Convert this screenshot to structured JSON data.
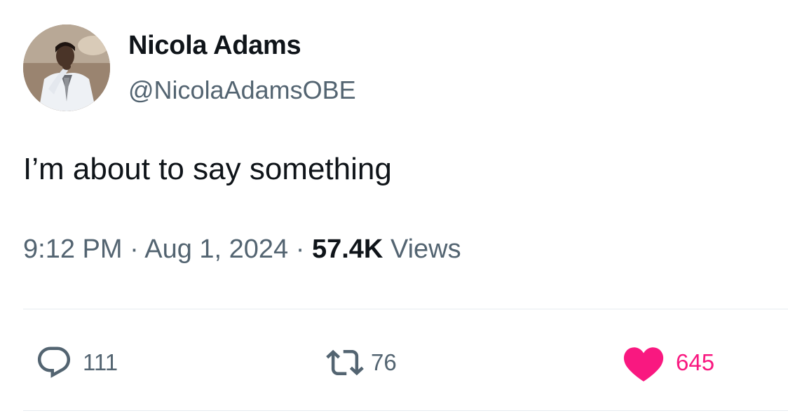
{
  "author": {
    "display_name": "Nicola Adams",
    "handle": "@NicolaAdamsOBE"
  },
  "tweet": {
    "text": "I’m about to say something"
  },
  "meta": {
    "time": "9:12 PM",
    "separator": "·",
    "date": "Aug 1, 2024",
    "views_count": "57.4K",
    "views_label": "Views"
  },
  "actions": {
    "reply": {
      "icon": "reply-icon",
      "count": "111"
    },
    "retweet": {
      "icon": "retweet-icon",
      "count": "76"
    },
    "like": {
      "icon": "heart-icon",
      "count": "645",
      "color": "#f91880"
    }
  },
  "colors": {
    "primary_text": "#0f1419",
    "secondary_text": "#536471",
    "like_active": "#f91880",
    "divider": "#e6ecf0"
  }
}
